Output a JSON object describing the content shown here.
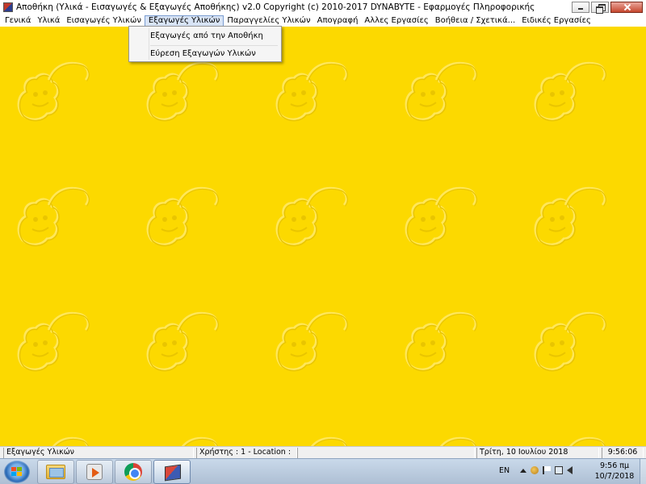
{
  "window": {
    "title": "Αποθήκη (Υλικά - Εισαγωγές & Εξαγωγές Αποθήκης)  v2.0   Copyright (c) 2010-2017  DYNABYTE - Εφαρμογές Πληροφορικής"
  },
  "menu": {
    "items": [
      {
        "label": "Γενικά"
      },
      {
        "label": "Υλικά"
      },
      {
        "label": "Εισαγωγές Υλικών"
      },
      {
        "label": "Εξαγωγές Υλικών"
      },
      {
        "label": "Παραγγελίες Υλικών"
      },
      {
        "label": "Απογραφή"
      },
      {
        "label": "Αλλες Εργασίες"
      },
      {
        "label": "Βοήθεια / Σχετικά..."
      },
      {
        "label": "Ειδικές Εργασίες"
      }
    ],
    "active_index": 3
  },
  "dropdown": {
    "items": [
      {
        "label": "Εξαγωγές από την Αποθήκη"
      },
      {
        "label": "Εύρεση Εξαγωγών Υλικών"
      }
    ]
  },
  "workspace": {
    "background_color": "#fcd900",
    "pattern_icon": "lion-emboss-icon"
  },
  "statusbar": {
    "section": "Εξαγωγές Υλικών",
    "user": "Χρήστης : 1  -  Location :",
    "date": "Τρίτη, 10 Ιουλίου 2018",
    "time": "9:56:06"
  },
  "taskbar": {
    "apps": [
      {
        "icon": "windows-explorer-icon"
      },
      {
        "icon": "media-player-icon"
      },
      {
        "icon": "chrome-icon"
      },
      {
        "icon": "warehouse-app-icon"
      }
    ],
    "language": "EN",
    "clock_time": "9:56 πμ",
    "clock_date": "10/7/2018"
  }
}
